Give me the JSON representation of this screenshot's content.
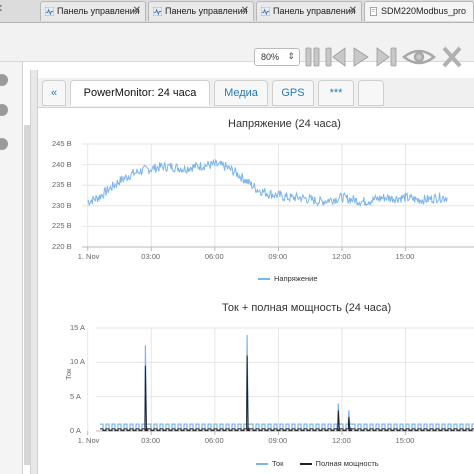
{
  "browser": {
    "tabs": [
      {
        "title": "Панель управления",
        "icon": "heart-monitor-icon",
        "close": "✕"
      },
      {
        "title": "Панель управления",
        "icon": "heart-monitor-icon",
        "close": "✕"
      },
      {
        "title": "Панель управления",
        "icon": "heart-monitor-icon",
        "close": "✕"
      },
      {
        "title": "SDM220Modbus_pro",
        "icon": "document-icon",
        "close": ""
      }
    ],
    "zoom": "80%"
  },
  "app": {
    "tabs": [
      {
        "label": "«"
      },
      {
        "label": "PowerMonitor: 24 часа"
      },
      {
        "label": "Медиа"
      },
      {
        "label": "GPS"
      },
      {
        "label": "***"
      }
    ]
  },
  "chart_data": [
    {
      "type": "line",
      "title": "Напряжение (24 часа)",
      "x_tick_labels": [
        "1. Nov",
        "03:00",
        "06:00",
        "09:00",
        "12:00",
        "15:00"
      ],
      "y_tick_labels": [
        "220 В",
        "225 В",
        "230 В",
        "235 В",
        "240 В",
        "245 В"
      ],
      "ylim": [
        220,
        245
      ],
      "grid": true,
      "legend_position": "bottom",
      "series": [
        {
          "name": "Напряжение",
          "color": "#7cb5ec",
          "x_hours": [
            0,
            0.5,
            1,
            1.5,
            2,
            2.5,
            3,
            3.5,
            4,
            4.5,
            5,
            5.5,
            6,
            6.5,
            7,
            7.5,
            8,
            8.5,
            9,
            9.5,
            10,
            10.5,
            11,
            11.5,
            12,
            12.5,
            13,
            13.5,
            14,
            14.5,
            15,
            15.5,
            16,
            16.5,
            17
          ],
          "values": [
            231,
            232,
            234,
            236,
            237.5,
            238.5,
            239,
            239.5,
            239.5,
            239,
            239.5,
            239.8,
            240,
            239.5,
            238,
            236,
            234,
            233,
            232.5,
            232,
            232,
            231.5,
            231,
            231.5,
            232,
            231.5,
            231,
            231.5,
            232,
            231.8,
            232,
            231.5,
            231.5,
            232,
            232
          ]
        }
      ]
    },
    {
      "type": "line",
      "title": "Ток + полная мощность (24 часа)",
      "x_tick_labels": [
        "1. Nov",
        "03:00",
        "06:00",
        "09:00",
        "12:00",
        "15:00"
      ],
      "y_tick_labels": [
        "0 A",
        "5 A",
        "10 A",
        "15 A"
      ],
      "ylabel": "Ток",
      "ylim": [
        0,
        15
      ],
      "grid": true,
      "legend_position": "bottom",
      "series": [
        {
          "name": "Ток",
          "color": "#7cb5ec",
          "spikes": [
            {
              "x": 2.7,
              "y": 12.5
            },
            {
              "x": 7.5,
              "y": 14
            },
            {
              "x": 11.8,
              "y": 4
            },
            {
              "x": 12.3,
              "y": 3
            }
          ],
          "baseline": 1
        },
        {
          "name": "Полная мощность",
          "color": "#222222",
          "spikes": [
            {
              "x": 2.7,
              "y": 9.5
            },
            {
              "x": 7.5,
              "y": 11
            },
            {
              "x": 11.8,
              "y": 3
            },
            {
              "x": 12.3,
              "y": 2
            }
          ],
          "baseline": 0.3
        }
      ]
    }
  ]
}
